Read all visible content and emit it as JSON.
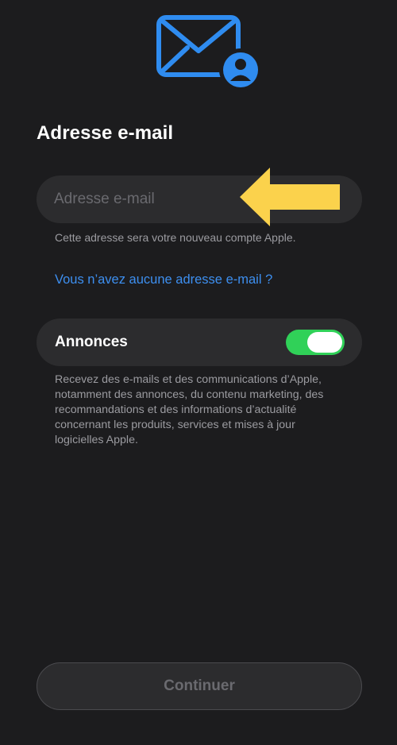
{
  "header": {
    "icon": "envelope-person-icon",
    "accent_color": "#2f8cf0"
  },
  "page_title": "Adresse e-mail",
  "email_field": {
    "value": "",
    "placeholder": "Adresse e-mail"
  },
  "annotation": {
    "icon": "arrow-left-icon",
    "color": "#fbd24c"
  },
  "email_hint": "Cette adresse sera votre nouveau compte Apple.",
  "no_email_link": "Vous n’avez aucune adresse e-mail ?",
  "announcements": {
    "label": "Annonces",
    "enabled": true,
    "switch_color": "#30d158",
    "description": "Recevez des e-mails et des communications d’Apple, notamment des annonces, du contenu marketing, des recommandations et des informations d’actualité concernant les produits, services et mises à jour logicielles Apple."
  },
  "continue_button": {
    "label": "Continuer",
    "enabled": false
  }
}
